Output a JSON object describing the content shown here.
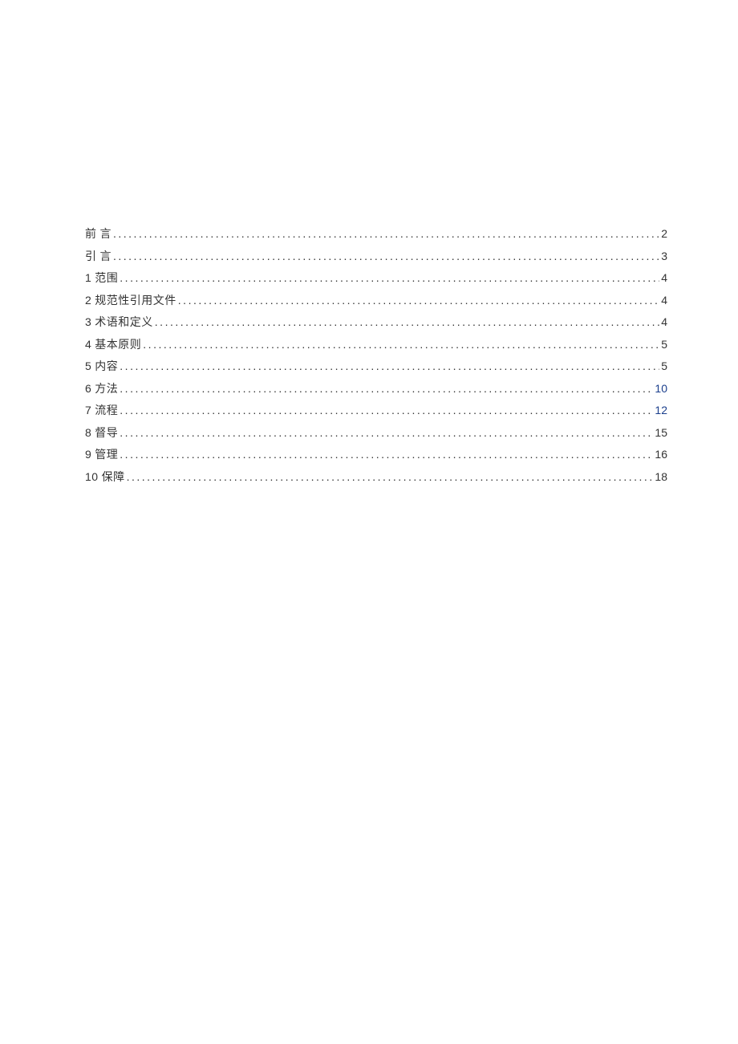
{
  "toc": {
    "entries": [
      {
        "num": "",
        "title": "前 言",
        "page": "2",
        "link": false
      },
      {
        "num": "",
        "title": "引 言",
        "page": "3",
        "link": false
      },
      {
        "num": "1",
        "title": "范围",
        "page": "4",
        "link": false
      },
      {
        "num": "2",
        "title": "规范性引用文件",
        "page": "4",
        "link": false
      },
      {
        "num": "3",
        "title": "术语和定义",
        "page": "4",
        "link": false
      },
      {
        "num": "4",
        "title": "基本原则",
        "page": "5",
        "link": false
      },
      {
        "num": "5",
        "title": "内容",
        "page": "5",
        "link": false
      },
      {
        "num": "6",
        "title": "方法",
        "page": "10",
        "link": true
      },
      {
        "num": "7",
        "title": "流程",
        "page": "12",
        "link": true
      },
      {
        "num": "8",
        "title": "督导",
        "page": "15",
        "link": false
      },
      {
        "num": "9",
        "title": "管理",
        "page": "16",
        "link": false
      },
      {
        "num": "10",
        "title": "保障",
        "page": "18",
        "link": false
      }
    ],
    "leader_char": "."
  }
}
